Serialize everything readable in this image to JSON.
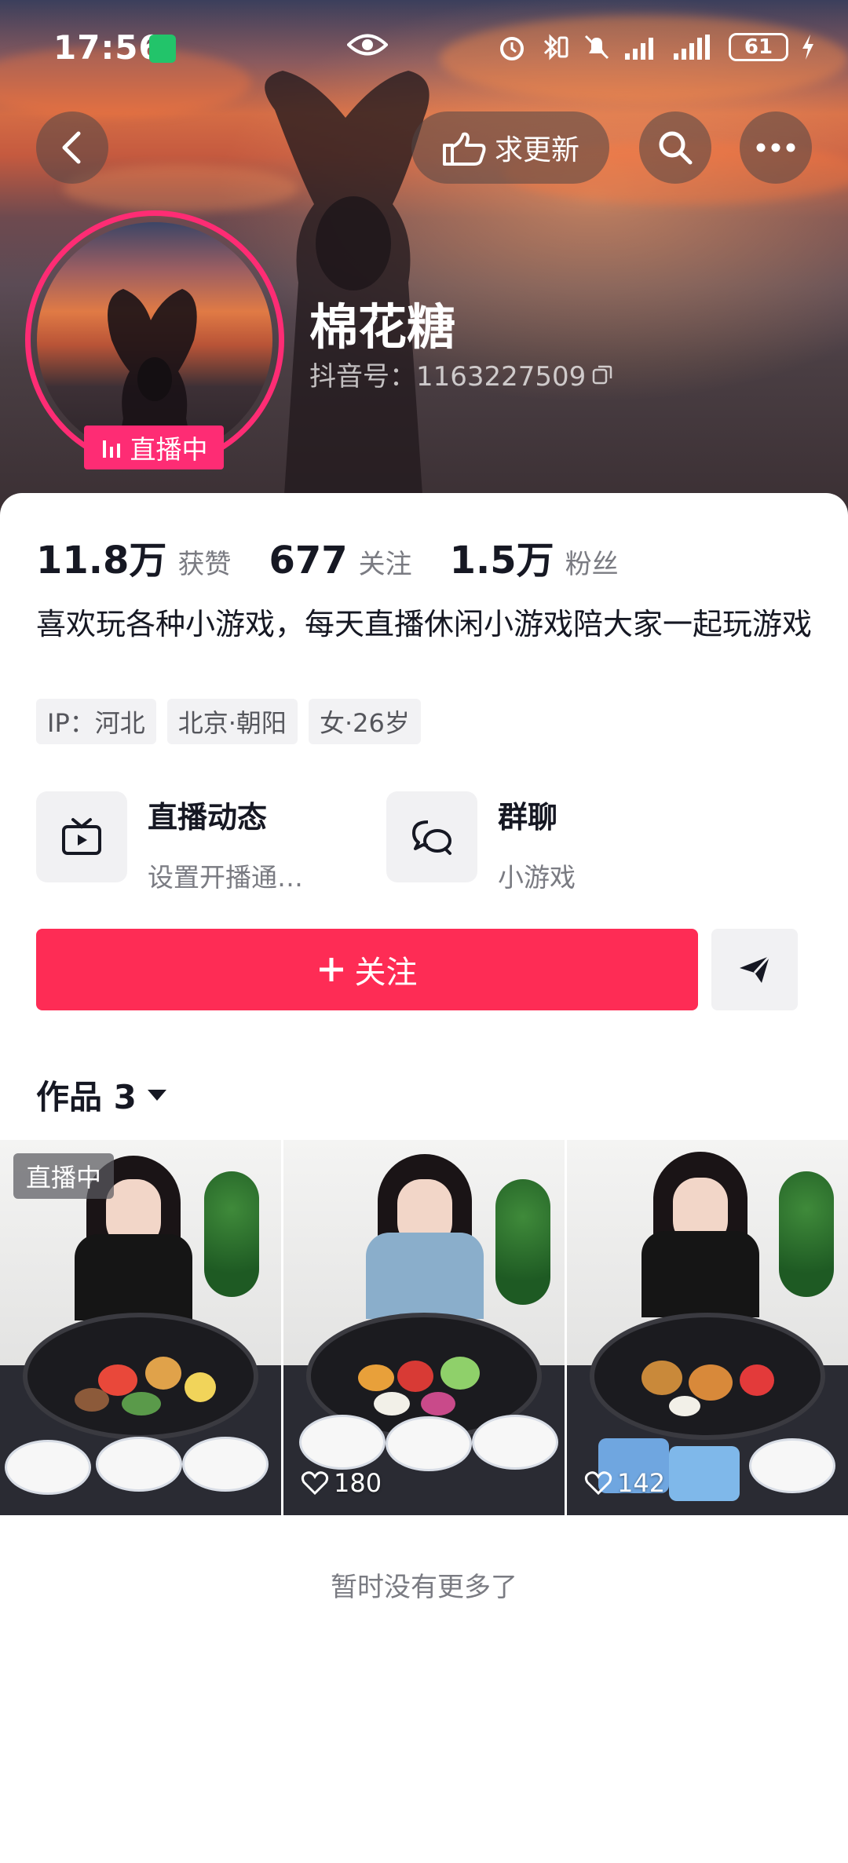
{
  "status_bar": {
    "time": "17:56",
    "battery": "61"
  },
  "header": {
    "update_label": "求更新"
  },
  "profile": {
    "name": "棉花糖",
    "douyin_id": "抖音号：1163227509",
    "live_badge": "直播中"
  },
  "stats": [
    {
      "value": "11.8万",
      "label": "获赞"
    },
    {
      "value": "677",
      "label": "关注"
    },
    {
      "value": "1.5万",
      "label": "粉丝"
    }
  ],
  "bio": "喜欢玩各种小游戏，每天直播休闲小游戏陪大家一起玩游戏",
  "tags": [
    "IP：河北",
    "北京·朝阳",
    "女·26岁"
  ],
  "features": [
    {
      "title": "直播动态",
      "sub": "设置开播通…",
      "icon": "tv-icon"
    },
    {
      "title": "群聊",
      "sub": "小游戏",
      "icon": "chat-bubbles-icon"
    }
  ],
  "actions": {
    "follow_label": "关注"
  },
  "works": {
    "title": "作品 3",
    "items": [
      {
        "badge": "直播中",
        "likes": ""
      },
      {
        "badge": "",
        "likes": "180"
      },
      {
        "badge": "",
        "likes": "142"
      }
    ]
  },
  "footer": {
    "no_more": "暂时没有更多了"
  },
  "colors": {
    "accent": "#fe2c55",
    "live_pink": "#fe2c74"
  }
}
